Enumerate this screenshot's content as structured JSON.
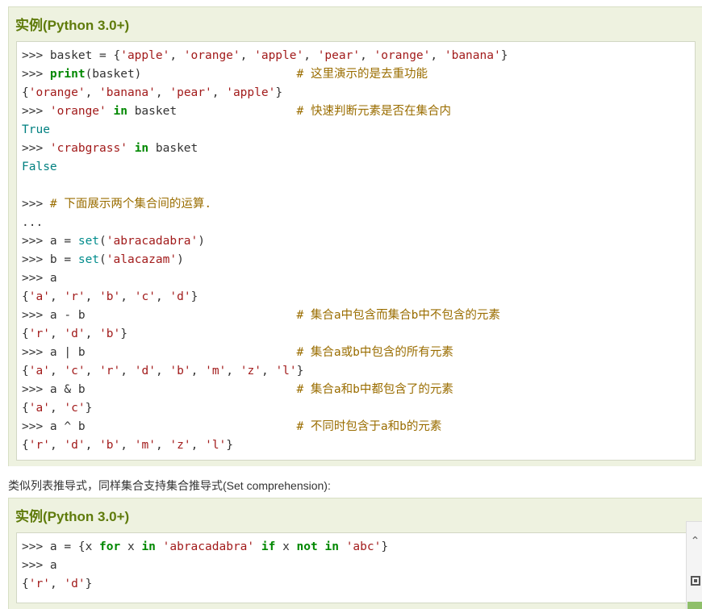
{
  "example1": {
    "title": "实例(Python 3.0+)"
  },
  "example2": {
    "title": "实例(Python 3.0+)"
  },
  "description": "类似列表推导式，同样集合支持集合推导式(Set comprehension):",
  "code1": [
    ">>> basket = {'apple', 'orange', 'apple', 'pear', 'orange', 'banana'}",
    ">>> print(basket)                      # 这里演示的是去重功能",
    "{'orange', 'banana', 'pear', 'apple'}",
    ">>> 'orange' in basket                 # 快速判断元素是否在集合内",
    "True",
    ">>> 'crabgrass' in basket",
    "False",
    "",
    ">>> # 下面展示两个集合间的运算.",
    "...",
    ">>> a = set('abracadabra')",
    ">>> b = set('alacazam')",
    ">>> a",
    "{'a', 'r', 'b', 'c', 'd'}",
    ">>> a - b                              # 集合a中包含而集合b中不包含的元素",
    "{'r', 'd', 'b'}",
    ">>> a | b                              # 集合a或b中包含的所有元素",
    "{'a', 'c', 'r', 'd', 'b', 'm', 'z', 'l'}",
    ">>> a & b                              # 集合a和b中都包含了的元素",
    "{'a', 'c'}",
    ">>> a ^ b                              # 不同时包含于a和b的元素",
    "{'r', 'd', 'b', 'm', 'z', 'l'}"
  ],
  "code2": [
    ">>> a = {x for x in 'abracadabra' if x not in 'abc'}",
    ">>> a",
    "{'r', 'd'}"
  ],
  "side_toolbar": {
    "top_icon": "back-to-top-icon",
    "qr_icon": "qr-code-icon"
  },
  "colors": {
    "title": "#5f7b0b",
    "keyword": "#008800",
    "string": "#a21b1b",
    "builtin": "#008c8c",
    "comment": "#9a6d00",
    "panel_bg": "#eef2e0"
  }
}
